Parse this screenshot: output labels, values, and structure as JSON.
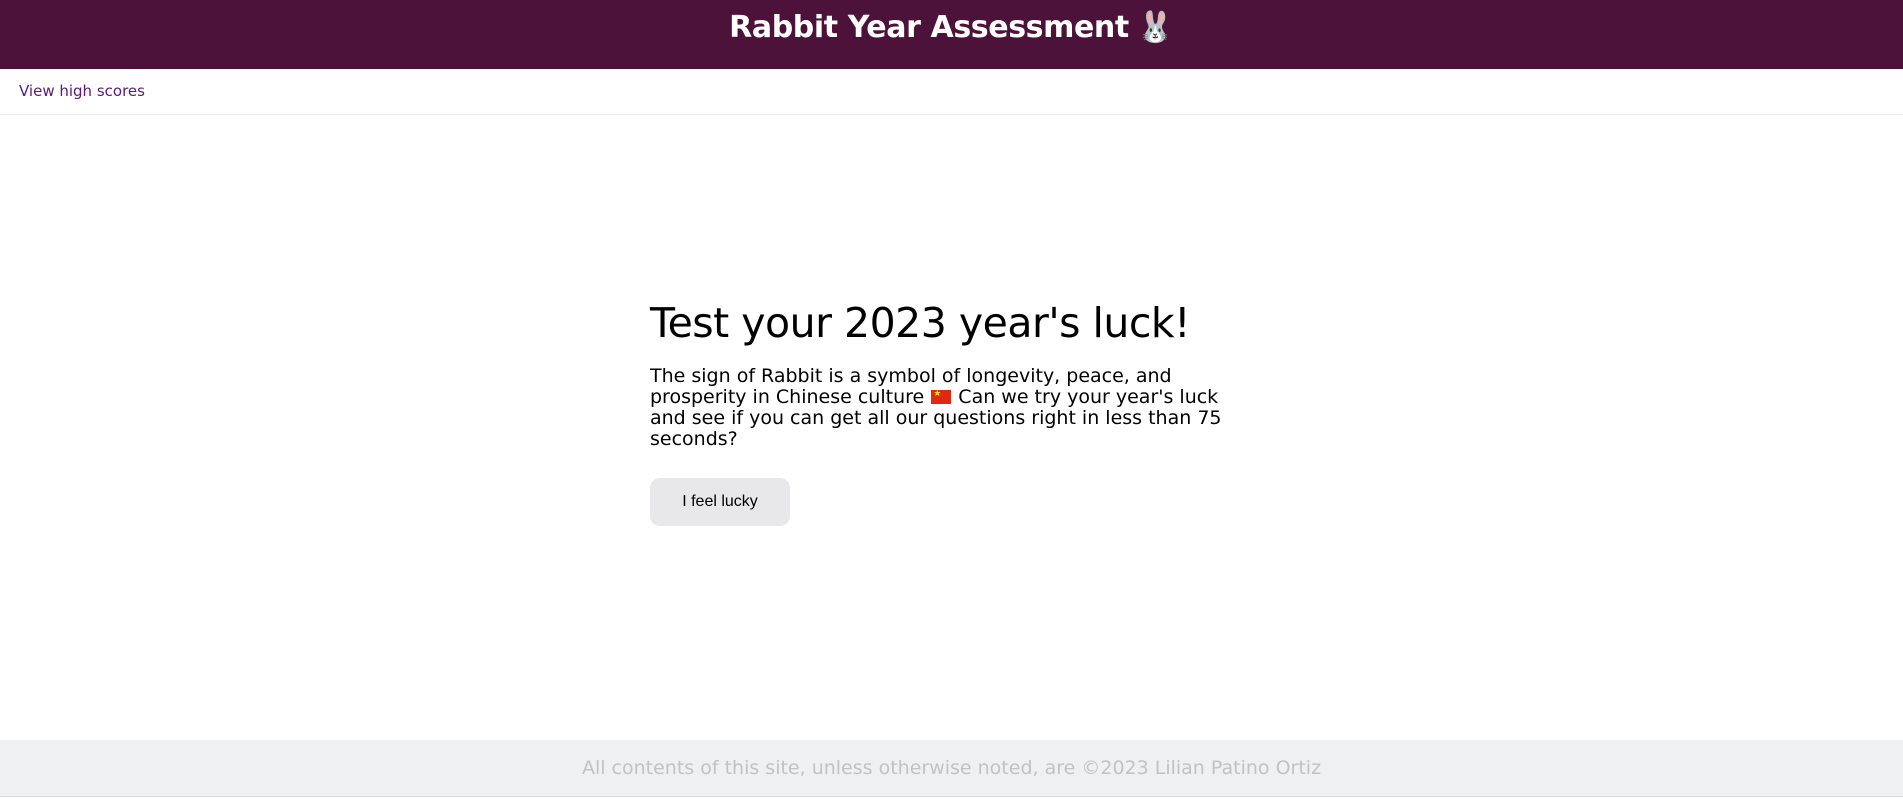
{
  "header": {
    "title": "Rabbit Year Assessment",
    "icon": "rabbit-face-icon",
    "icon_glyph": "🐰",
    "background_color": "#4d123a"
  },
  "nav": {
    "high_scores_link": "View high scores"
  },
  "intro": {
    "title": "Test your 2023 year's luck!",
    "text_before_flag": "The sign of Rabbit is a symbol of longevity, peace, and prosperity in Chinese culture",
    "flag_icon": "china-flag-icon",
    "text_after_flag": "Can we try your year's luck and see if you can get all our questions right in less than 75 seconds?",
    "button_label": "I feel lucky"
  },
  "footer": {
    "text": "All contents of this site, unless otherwise noted, are ©2023 Lilian Patino Ortiz"
  }
}
